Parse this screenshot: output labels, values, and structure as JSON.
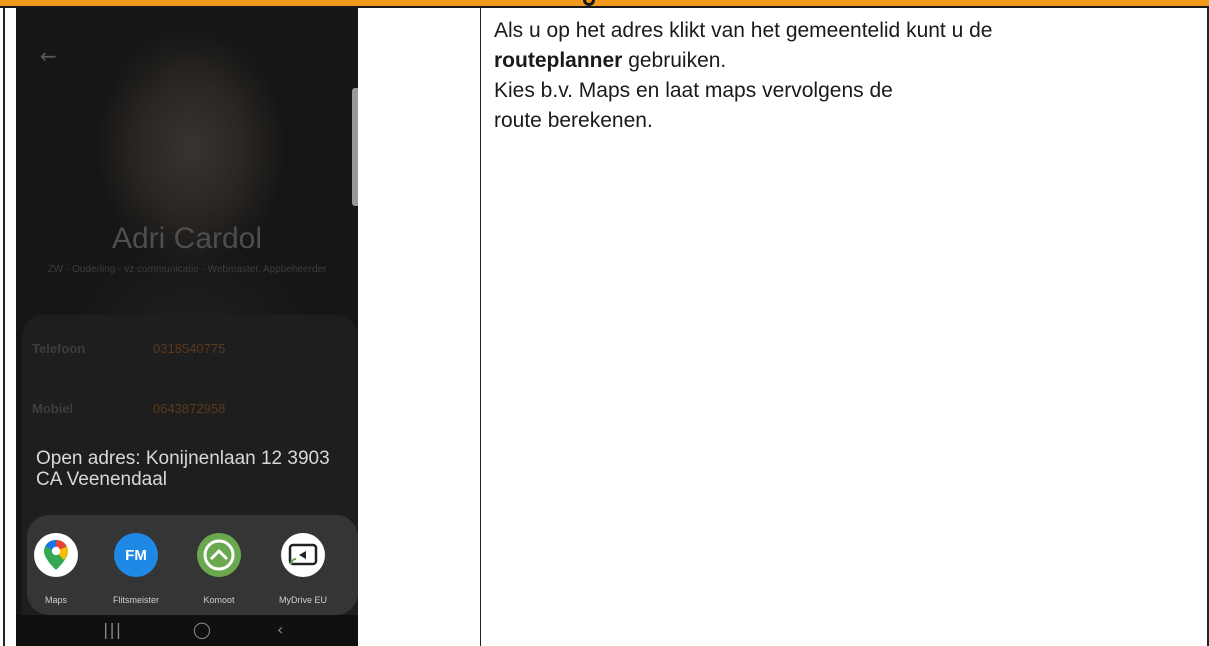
{
  "profile": {
    "name": "Adri Cardol",
    "roles": "ZW - Ouderling - vz communicatie - Webmaster, Appbeheerder"
  },
  "contact": {
    "phone_label": "Telefoon",
    "phone_value": "0318540775",
    "mobile_label": "Mobiel",
    "mobile_value": "0643872958"
  },
  "open_address": "Open adres: Konijnenlaan 12 3903 CA Veenendaal",
  "apps": [
    {
      "label": "Maps",
      "color": "#ffffff"
    },
    {
      "label": "Flitsmeister",
      "color": "#1e88e5"
    },
    {
      "label": "Komoot",
      "color": "#6aa84f"
    },
    {
      "label": "MyDrive EU",
      "color": "#ffffff"
    }
  ],
  "flitsmeister_badge": "FM",
  "instructions": {
    "line1": "Als u op het adres klikt van het gemeentelid kunt u de",
    "line2_bold": "routeplanner",
    "line2_rest": " gebruiken.",
    "line3": "Kies b.v. Maps en laat maps vervolgens de route berekenen."
  },
  "colors": {
    "header": "#f29a1c"
  }
}
